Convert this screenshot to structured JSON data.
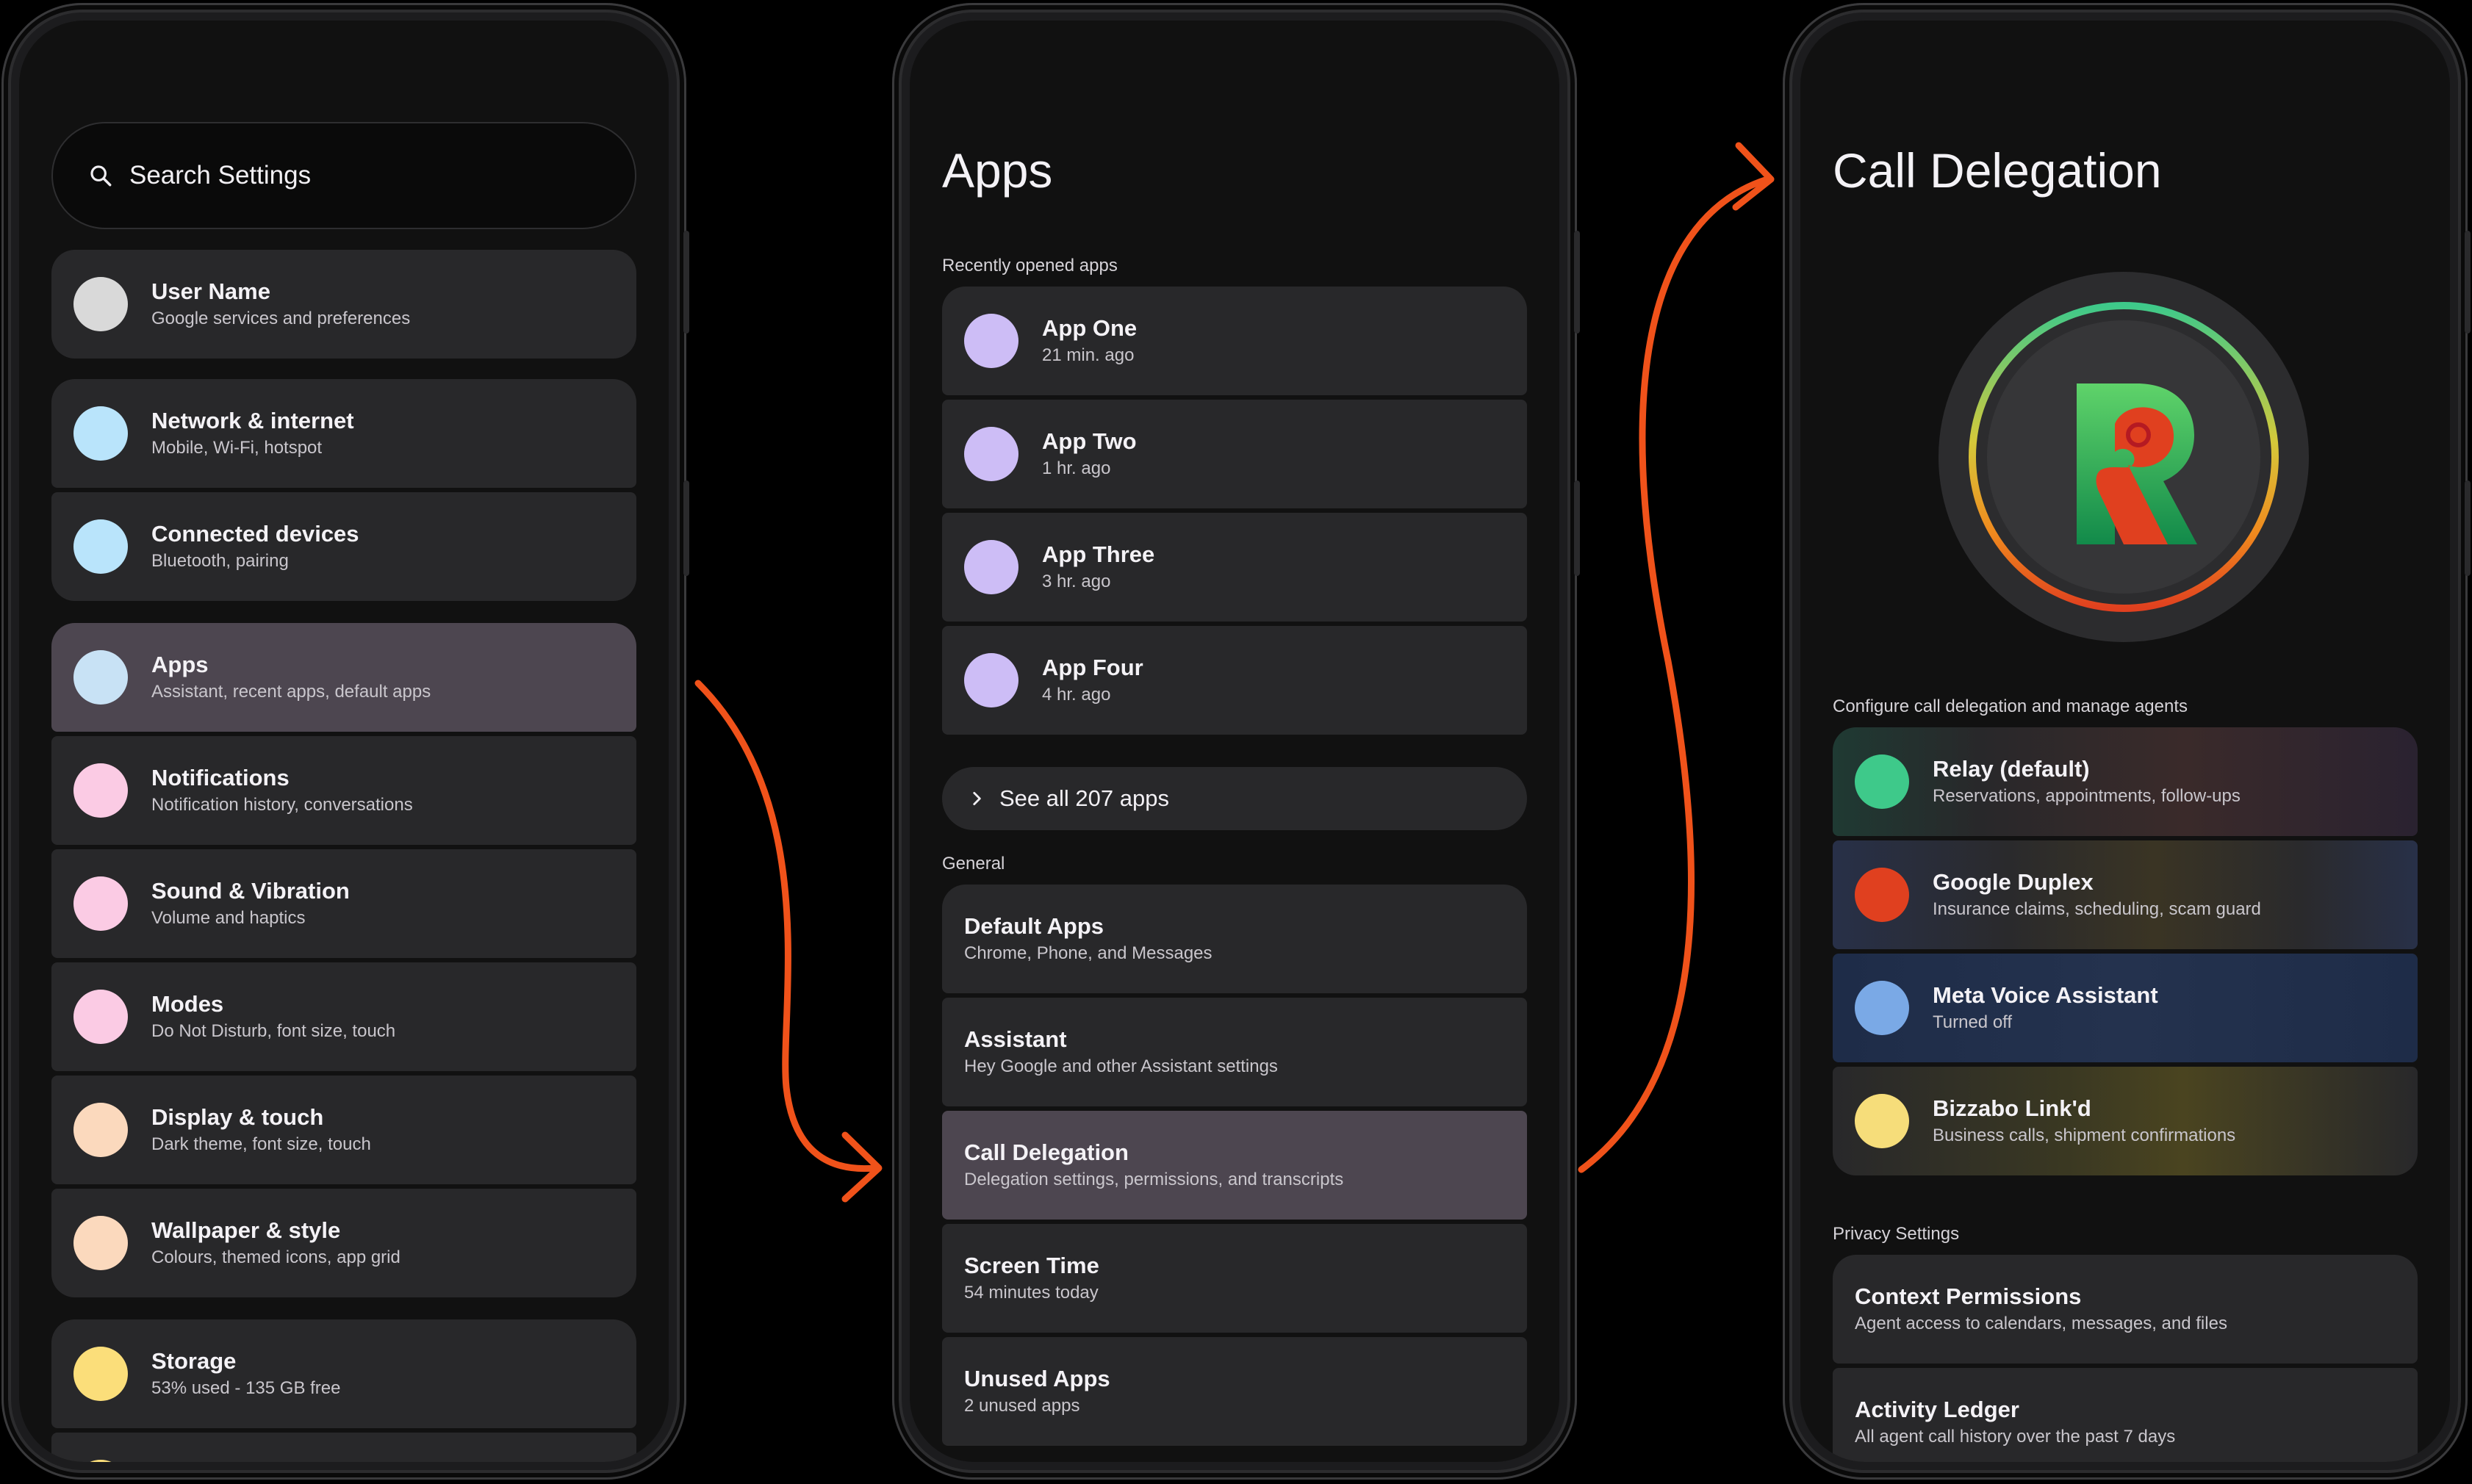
{
  "phone1": {
    "search": {
      "label": "Search Settings",
      "icon": "search-icon"
    },
    "items": [
      {
        "title": "User Name",
        "subtitle": "Google services and preferences",
        "color": "#d9d9d9"
      },
      {
        "title": "Network & internet",
        "subtitle": "Mobile, Wi-Fi, hotspot",
        "color": "#b9e4fb"
      },
      {
        "title": "Connected devices",
        "subtitle": "Bluetooth, pairing",
        "color": "#b9e4fb"
      },
      {
        "title": "Apps",
        "subtitle": "Assistant, recent apps, default apps",
        "color": "#c8e2f5"
      },
      {
        "title": "Notifications",
        "subtitle": "Notification history, conversations",
        "color": "#fbcbe4"
      },
      {
        "title": "Sound & Vibration",
        "subtitle": "Volume and haptics",
        "color": "#fbcbe4"
      },
      {
        "title": "Modes",
        "subtitle": "Do Not Disturb, font size, touch",
        "color": "#fbcbe4"
      },
      {
        "title": "Display & touch",
        "subtitle": "Dark theme, font size, touch",
        "color": "#fbd9bd"
      },
      {
        "title": "Wallpaper & style",
        "subtitle": "Colours, themed icons, app grid",
        "color": "#fbd9bd"
      },
      {
        "title": "Storage",
        "subtitle": "53% used - 135 GB free",
        "color": "#fbde7a"
      }
    ]
  },
  "phone2": {
    "title": "Apps",
    "recent_label": "Recently opened apps",
    "recent": [
      {
        "title": "App One",
        "subtitle": "21 min. ago",
        "color": "#cdbdf6"
      },
      {
        "title": "App Two",
        "subtitle": "1 hr. ago",
        "color": "#cdbdf6"
      },
      {
        "title": "App Three",
        "subtitle": "3 hr. ago",
        "color": "#cdbdf6"
      },
      {
        "title": "App Four",
        "subtitle": "4 hr. ago",
        "color": "#cdbdf6"
      }
    ],
    "see_all": "See all 207 apps",
    "general_label": "General",
    "general": [
      {
        "title": "Default Apps",
        "subtitle": "Chrome, Phone, and Messages"
      },
      {
        "title": "Assistant",
        "subtitle": "Hey Google and other Assistant settings"
      },
      {
        "title": "Call Delegation",
        "subtitle": "Delegation settings, permissions, and transcripts"
      },
      {
        "title": "Screen Time",
        "subtitle": "54 minutes today"
      },
      {
        "title": "Unused Apps",
        "subtitle": "2 unused apps"
      }
    ]
  },
  "phone3": {
    "title": "Call Delegation",
    "logo_icon": "relay-logo-icon",
    "configure_label": "Configure call delegation and manage agents",
    "agents": [
      {
        "title": "Relay (default)",
        "subtitle": "Reservations, appointments, follow-ups",
        "color": "#3ec98a"
      },
      {
        "title": "Google Duplex",
        "subtitle": "Insurance claims, scheduling, scam guard",
        "color": "#e0401f"
      },
      {
        "title": "Meta Voice Assistant",
        "subtitle": "Turned off",
        "color": "#7aa9e6"
      },
      {
        "title": "Bizzabo Link'd",
        "subtitle": "Business calls, shipment confirmations",
        "color": "#f6dd7a"
      }
    ],
    "privacy_label": "Privacy Settings",
    "privacy": [
      {
        "title": "Context Permissions",
        "subtitle": "Agent access to calendars, messages, and files"
      },
      {
        "title": "Activity Ledger",
        "subtitle": "All agent call history over the past 7 days"
      }
    ]
  },
  "arrow_color": "#f0521a"
}
